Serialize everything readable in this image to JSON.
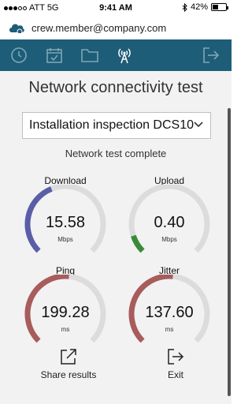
{
  "status_bar": {
    "carrier": "ATT 5G",
    "time": "9:41 AM",
    "battery_percent": "42%",
    "battery_level": 0.42
  },
  "account": {
    "email": "crew.member@company.com",
    "icon": "cloud-icon",
    "icon_color": "#1d5d78"
  },
  "toolbar": {
    "background": "#1d5d78",
    "items": [
      {
        "icon": "history-clock-icon"
      },
      {
        "icon": "calendar-check-icon"
      },
      {
        "icon": "folder-icon"
      },
      {
        "icon": "antenna-icon",
        "active": true
      },
      {
        "icon": "logout-icon"
      }
    ]
  },
  "main": {
    "title": "Network connectivity test",
    "selected_installation": "Installation inspection DCS10",
    "status": "Network test complete"
  },
  "gauges": [
    {
      "label": "Download",
      "value": "15.58",
      "unit": "Mbps",
      "level": 0.42,
      "color": "#5a5ea8"
    },
    {
      "label": "Upload",
      "value": "0.40",
      "unit": "Mbps",
      "level": 0.1,
      "color": "#3a8a3a"
    },
    {
      "label": "Ping",
      "value": "199.28",
      "unit": "ms",
      "level": 0.52,
      "color": "#a85c5c"
    },
    {
      "label": "Jitter",
      "value": "137.60",
      "unit": "ms",
      "level": 0.52,
      "color": "#a85c5c"
    }
  ],
  "actions": {
    "share_label": "Share results",
    "exit_label": "Exit"
  }
}
